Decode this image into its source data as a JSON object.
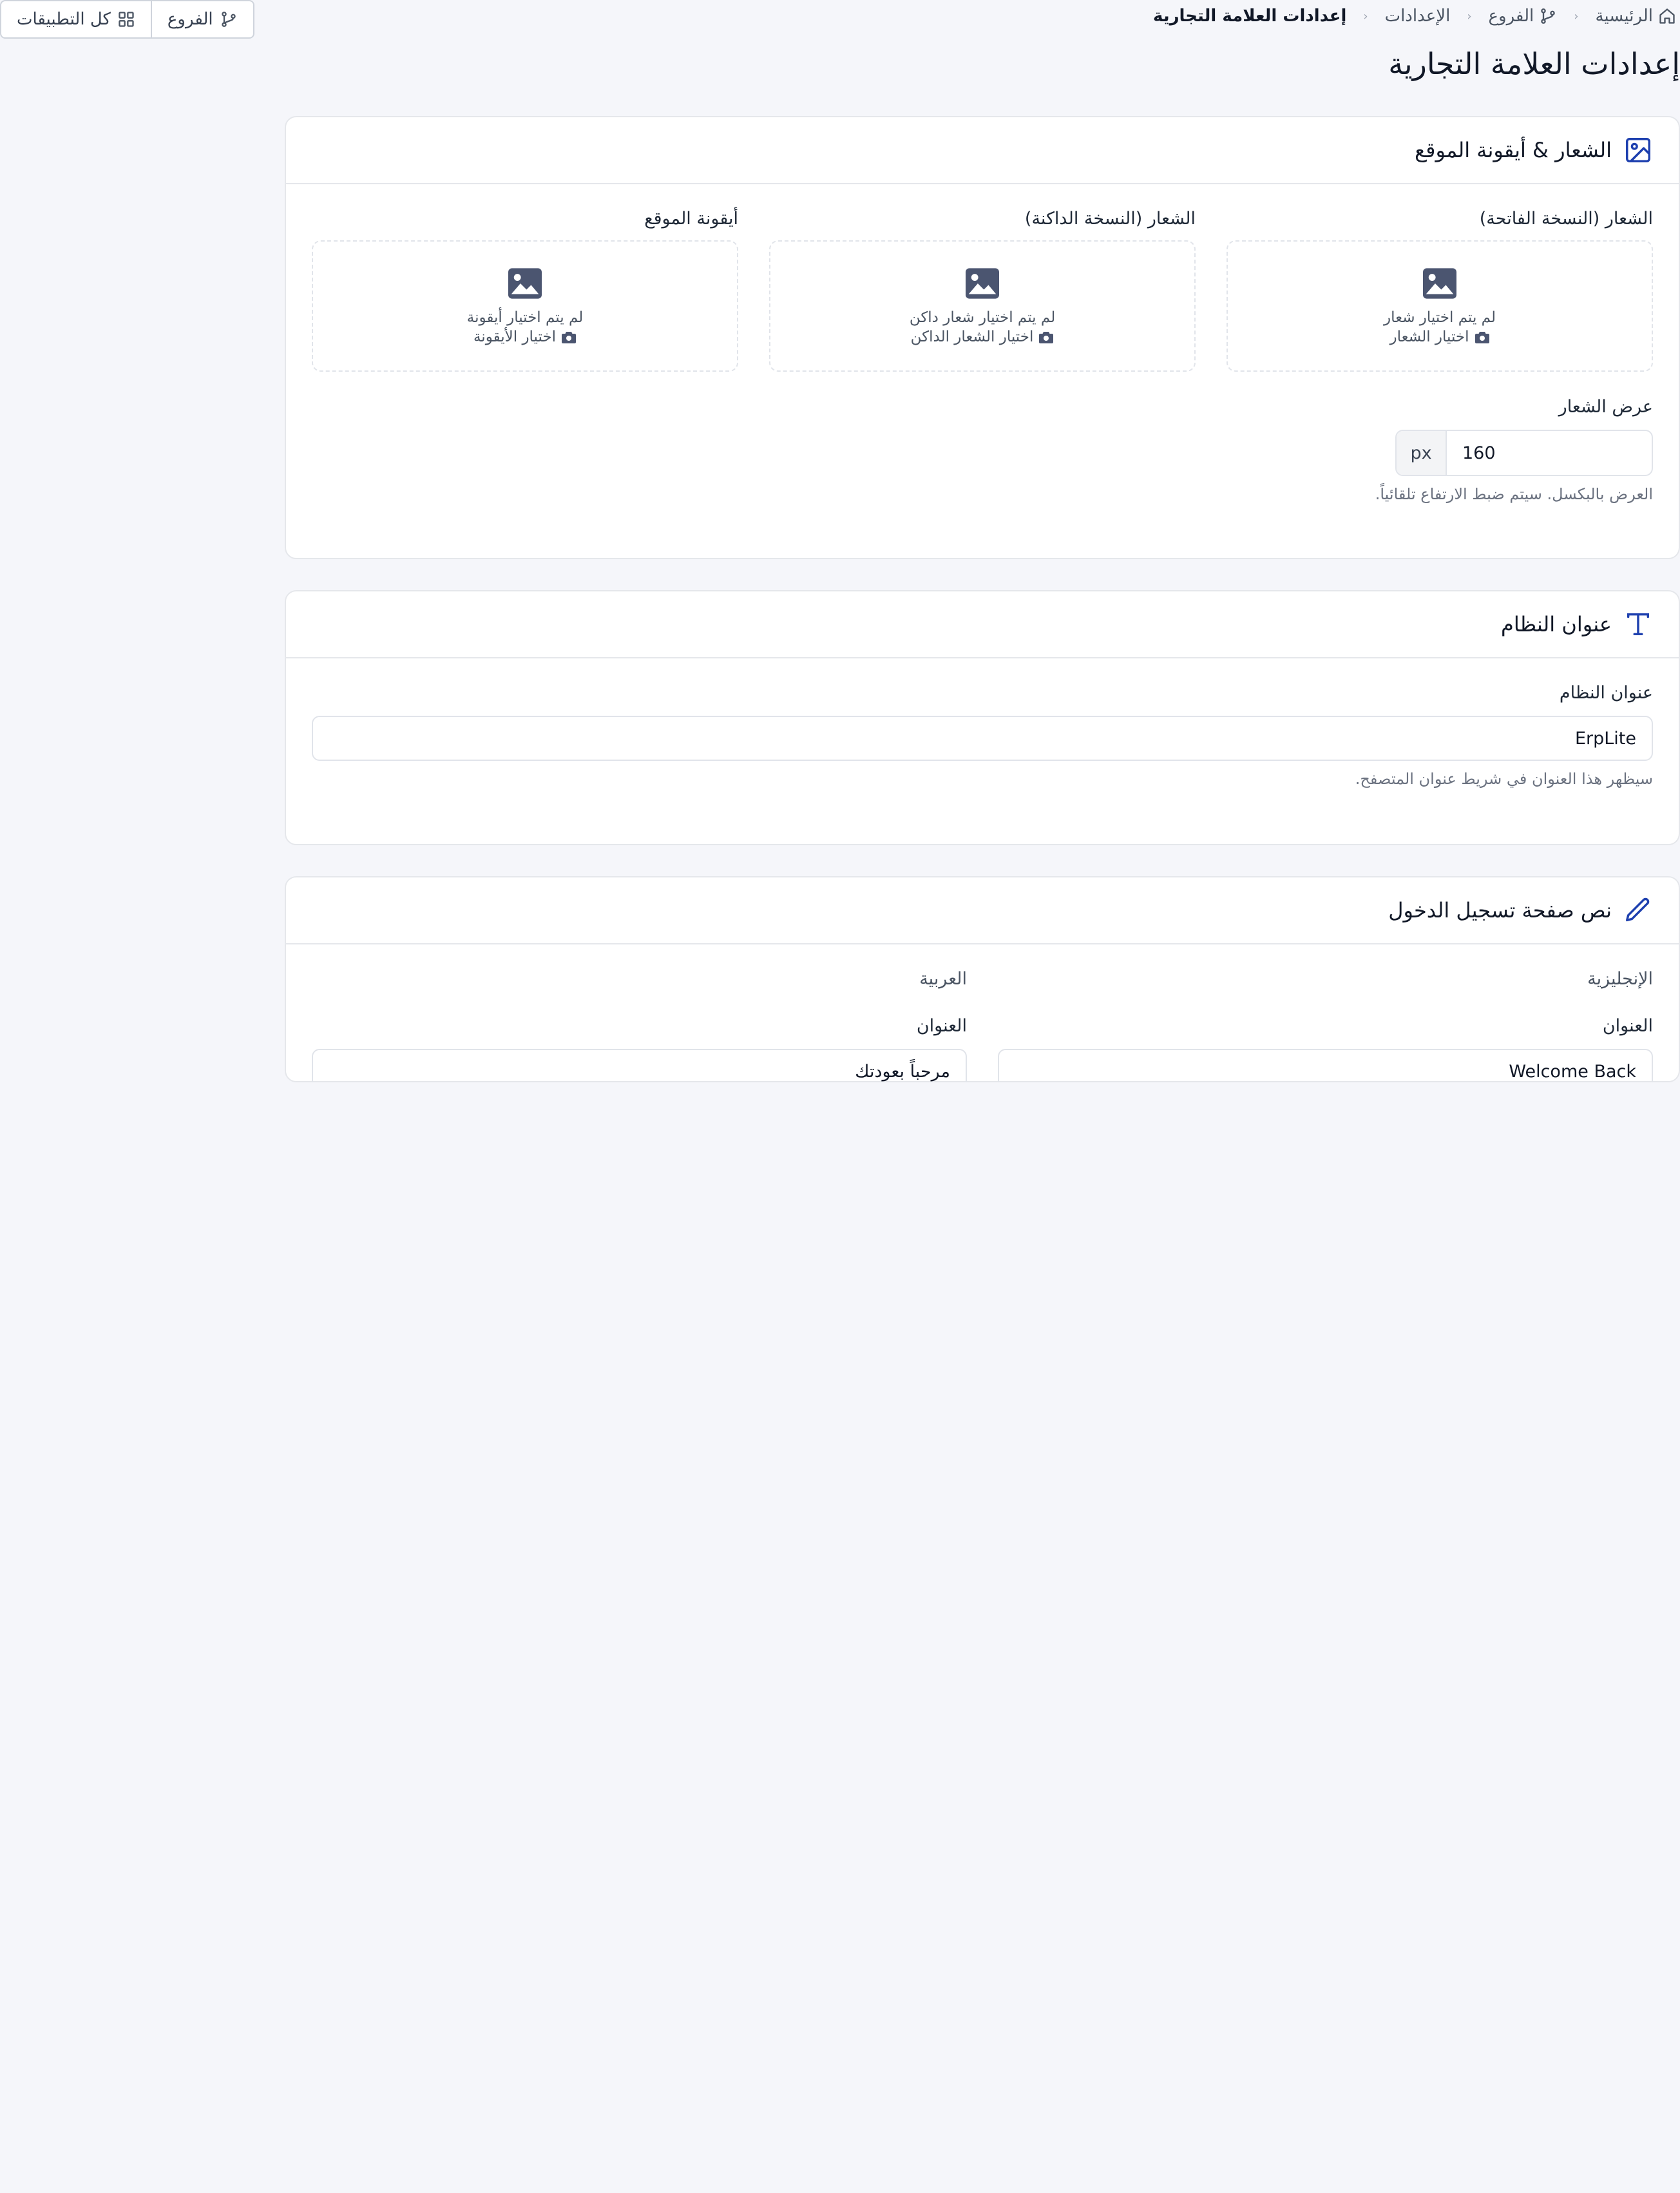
{
  "breadcrumb": {
    "home": "الرئيسية",
    "branches": "الفروع",
    "settings": "الإعدادات",
    "current": "إعدادات العلامة التجارية"
  },
  "top_actions": {
    "all_apps": "كل التطبيقات",
    "branches": "الفروع"
  },
  "page_title": "إعدادات العلامة التجارية",
  "logo_card": {
    "title": "الشعار & أيقونة الموقع",
    "uploads": [
      {
        "label": "الشعار (النسخة الفاتحة)",
        "empty": "لم يتم اختيار شعار",
        "pick": "اختيار الشعار"
      },
      {
        "label": "الشعار (النسخة الداكنة)",
        "empty": "لم يتم اختيار شعار داكن",
        "pick": "اختيار الشعار الداكن"
      },
      {
        "label": "أيقونة الموقع",
        "empty": "لم يتم اختيار أيقونة",
        "pick": "اختيار الأيقونة"
      }
    ],
    "width_label": "عرض الشعار",
    "width_value": "160",
    "width_unit": "px",
    "width_hint": "العرض بالبكسل. سيتم ضبط الارتفاع تلقائياً."
  },
  "system_card": {
    "title": "عنوان النظام",
    "field_label": "عنوان النظام",
    "value": "ErpLite",
    "hint": "سيظهر هذا العنوان في شريط عنوان المتصفح."
  },
  "login_card": {
    "title": "نص صفحة تسجيل الدخول",
    "english": {
      "heading": "الإنجليزية",
      "field_label": "العنوان",
      "value": "Welcome Back"
    },
    "arabic": {
      "heading": "العربية",
      "field_label": "العنوان",
      "value": "مرحباً بعودتك"
    }
  },
  "colors": {
    "accent": "#1e40af",
    "background": "#f5f6fa",
    "card": "#ffffff",
    "border": "#e5e7eb"
  }
}
